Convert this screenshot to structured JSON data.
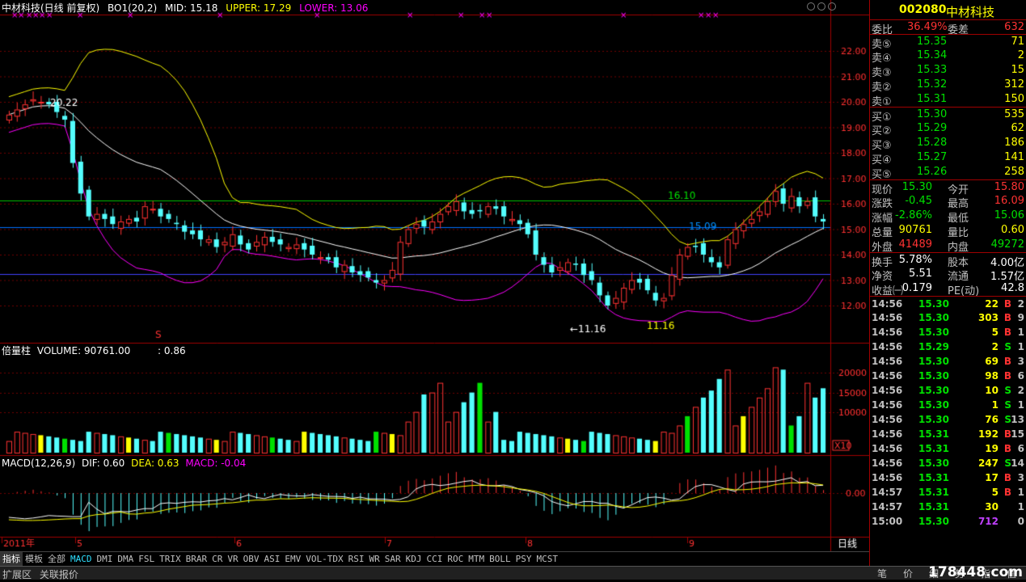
{
  "header": {
    "title": "中材科技(日线 前复权)",
    "indicator": "BO1(20,2)",
    "mid": "MID: 15.18",
    "upper": "UPPER: 17.29",
    "lower": "LOWER: 13.06"
  },
  "price_axis": [
    "22.00",
    "21.00",
    "20.00",
    "19.00",
    "18.00",
    "17.00",
    "16.00",
    "15.00",
    "14.00",
    "13.00",
    "12.00"
  ],
  "price_labels": {
    "high": "20.22",
    "low": "←11.16",
    "low2": "11.16",
    "line_green": "16.10",
    "line_blue": "15.09",
    "s_marker": "S"
  },
  "volume_header": {
    "name": "倍量柱",
    "volume": "VOLUME: 90761.00",
    "ratio": ": 0.86"
  },
  "volume_axis": [
    "20000",
    "15000",
    "10000"
  ],
  "volume_scale": "X10",
  "macd_header": {
    "name": "MACD(12,26,9)",
    "dif": "DIF: 0.60",
    "dea": "DEA: 0.63",
    "macd": "MACD: -0.04"
  },
  "macd_axis": "0.00",
  "date_axis": [
    "2011年",
    "5",
    "6",
    "7",
    "8",
    "9"
  ],
  "period_label": "日线",
  "side": {
    "code": "002080",
    "name": "中材科技",
    "ratio": {
      "label1": "委比",
      "val1": "36.49%",
      "label2": "委差",
      "val2": "632"
    },
    "asks": [
      [
        "卖⑤",
        "15.35",
        "71"
      ],
      [
        "卖④",
        "15.34",
        "2"
      ],
      [
        "卖③",
        "15.33",
        "15"
      ],
      [
        "卖②",
        "15.32",
        "312"
      ],
      [
        "卖①",
        "15.31",
        "150"
      ]
    ],
    "bids": [
      [
        "买①",
        "15.30",
        "535"
      ],
      [
        "买②",
        "15.29",
        "62"
      ],
      [
        "买③",
        "15.28",
        "186"
      ],
      [
        "买④",
        "15.27",
        "141"
      ],
      [
        "买⑤",
        "15.26",
        "258"
      ]
    ],
    "quote": [
      [
        "现价",
        "15.30",
        "今开",
        "15.80"
      ],
      [
        "涨跌",
        "-0.45",
        "最高",
        "16.09"
      ],
      [
        "涨幅",
        "-2.86%",
        "最低",
        "15.06"
      ],
      [
        "总量",
        "90761",
        "量比",
        "0.60"
      ],
      [
        "外盘",
        "41489",
        "内盘",
        "49272"
      ]
    ],
    "fin": [
      [
        "换手",
        "5.78%",
        "股本",
        "4.00亿"
      ],
      [
        "净资",
        "5.51",
        "流通",
        "1.57亿"
      ],
      [
        "收益㈠",
        "0.179",
        "PE(动)",
        "42.8"
      ]
    ],
    "ticks": [
      [
        "14:56",
        "15.30",
        "22",
        "B",
        "2"
      ],
      [
        "14:56",
        "15.30",
        "303",
        "B",
        "9"
      ],
      [
        "14:56",
        "15.30",
        "5",
        "B",
        "1"
      ],
      [
        "14:56",
        "15.29",
        "2",
        "S",
        "1"
      ],
      [
        "14:56",
        "15.30",
        "69",
        "B",
        "3"
      ],
      [
        "14:56",
        "15.30",
        "98",
        "B",
        "6"
      ],
      [
        "14:56",
        "15.30",
        "10",
        "S",
        "2"
      ],
      [
        "14:56",
        "15.30",
        "1",
        "S",
        "1"
      ],
      [
        "14:56",
        "15.30",
        "76",
        "S",
        "13"
      ],
      [
        "14:56",
        "15.31",
        "192",
        "B",
        "15"
      ],
      [
        "14:56",
        "15.31",
        "19",
        "B",
        "6"
      ],
      [
        "14:56",
        "15.30",
        "247",
        "S",
        "14"
      ],
      [
        "14:56",
        "15.31",
        "17",
        "B",
        "3"
      ],
      [
        "14:57",
        "15.31",
        "5",
        "B",
        "1"
      ],
      [
        "14:57",
        "15.31",
        "30",
        "",
        "1"
      ],
      [
        "15:00",
        "15.30",
        "712",
        "",
        "0"
      ]
    ]
  },
  "tabs": [
    "指标",
    "模板",
    "全部",
    "MACD",
    "DMI",
    "DMA",
    "FSL",
    "TRIX",
    "BRAR",
    "CR",
    "VR",
    "OBV",
    "ASI",
    "EMV",
    "VOL-TDX",
    "RSI",
    "WR",
    "SAR",
    "KDJ",
    "CCI",
    "ROC",
    "MTM",
    "BOLL",
    "PSY",
    "MCST"
  ],
  "footer": {
    "expand": "扩展区",
    "related": "关联报价"
  },
  "bottom_tabs": [
    "笔",
    "价",
    "细",
    "势",
    "指",
    "值"
  ],
  "watermark": "178448.com",
  "colors": {
    "up": "#ff3232",
    "down": "#54ffff",
    "boll_upper": "#ffff00",
    "boll_mid": "#ffffff",
    "boll_lower": "#ff00ff",
    "green_line": "#00c000",
    "blue_line": "#0070ff"
  },
  "chart_data": {
    "type": "candlestick",
    "closes": [
      19.5,
      19.7,
      19.9,
      20.1,
      20.0,
      19.9,
      19.6,
      19.3,
      17.6,
      16.4,
      15.5,
      15.6,
      15.4,
      15.2,
      15.3,
      15.4,
      15.3,
      15.9,
      15.8,
      15.5,
      15.4,
      15.2,
      14.9,
      14.8,
      14.6,
      14.6,
      14.3,
      14.5,
      14.8,
      14.4,
      14.2,
      14.5,
      14.7,
      14.5,
      14.4,
      14.3,
      14.4,
      14.2,
      14.0,
      13.9,
      13.8,
      13.5,
      13.6,
      13.3,
      13.2,
      13.1,
      12.9,
      13.0,
      13.4,
      14.5,
      15.0,
      15.2,
      15.1,
      15.3,
      15.6,
      15.9,
      16.1,
      15.7,
      15.6,
      15.7,
      15.9,
      15.8,
      15.5,
      15.4,
      15.2,
      14.8,
      14.0,
      13.6,
      13.3,
      13.5,
      13.7,
      13.6,
      13.2,
      13.0,
      12.4,
      12.0,
      12.3,
      12.7,
      13.0,
      12.9,
      12.6,
      12.2,
      12.3,
      13.2,
      14.0,
      14.3,
      14.3,
      14.0,
      13.7,
      13.5,
      14.6,
      15.0,
      15.2,
      15.4,
      15.7,
      16.1,
      16.5,
      16.0,
      16.3,
      15.9,
      16.1,
      15.5,
      15.3
    ]
  }
}
